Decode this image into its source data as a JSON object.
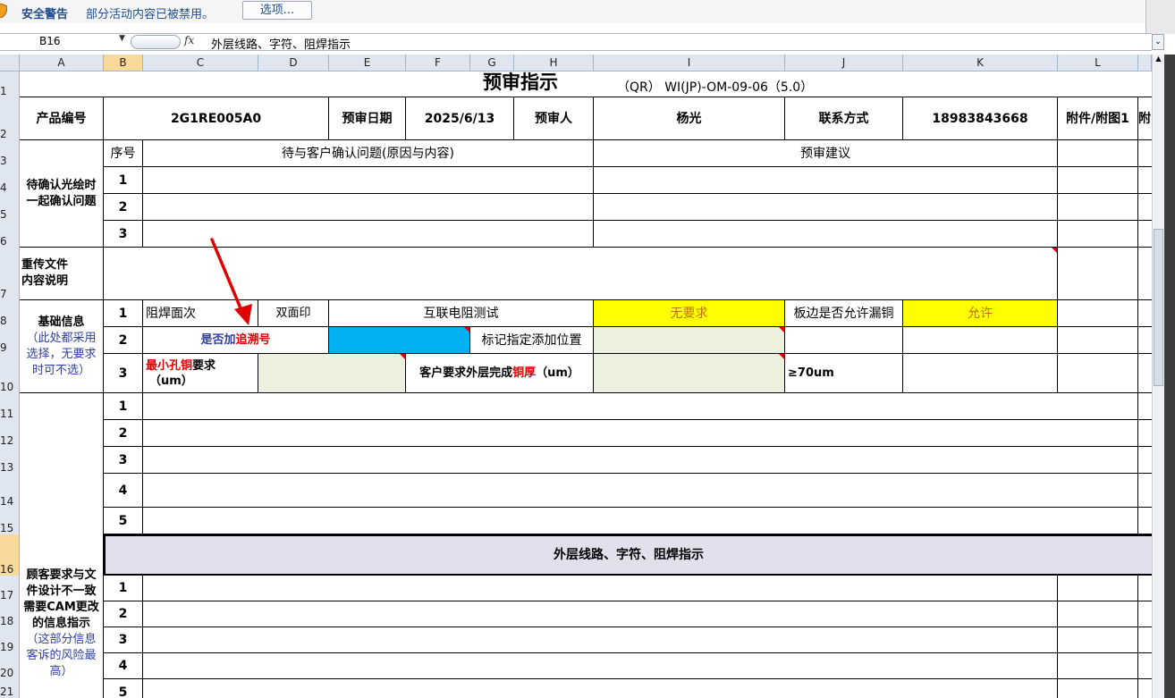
{
  "security_bar": {
    "title": "安全警告",
    "message": "部分活动内容已被禁用。",
    "options_button": "选项..."
  },
  "formula_bar": {
    "name_box": "B16",
    "fx": "fx",
    "value": "外层线路、字符、阻焊指示"
  },
  "columns": [
    "A",
    "B",
    "C",
    "D",
    "E",
    "F",
    "G",
    "H",
    "I",
    "J",
    "K",
    "L"
  ],
  "rows": [
    "1",
    "2",
    "3",
    "4",
    "5",
    "6",
    "7",
    "8",
    "9",
    "10",
    "11",
    "12",
    "13",
    "14",
    "15",
    "16",
    "17",
    "18",
    "19",
    "20",
    "21"
  ],
  "sheet": {
    "title": "预审指示",
    "form_code": "（QR） WI(JP)-OM-09-06（5.0）",
    "product_no_label": "产品编号",
    "product_no": "2G1RE005A0",
    "review_date_label": "预审日期",
    "review_date": "2025/6/13",
    "reviewer_label": "预审人",
    "reviewer": "杨光",
    "contact_label": "联系方式",
    "contact": "18983843668",
    "attachment_label": "附件/附图1",
    "attachment_label2": "附",
    "seq_label": "序号",
    "pending_issues_label": "待与客户确认问题(原因与内容)",
    "review_advice_label": "预审建议",
    "confirm_section": "待确认光绘时一起确认问题",
    "reupload_label": "重传文件\n内容说明",
    "basic_info_label": "基础信息",
    "basic_info_note": "（此处都采用选择，无要求时可不选）",
    "n1": "1",
    "n2": "2",
    "n3": "3",
    "n4": "4",
    "n5": "5",
    "mask_side_label": "阻焊面次",
    "mask_side_value": "双面印",
    "interconnect_label": "互联电阻测试",
    "interconnect_value": "无要求",
    "edge_copper_label": "板边是否允许漏铜",
    "edge_copper_value": "允许",
    "trace_label_a": "是否加",
    "trace_label_b": "追溯号",
    "mark_position_label": "标记指定添加位置",
    "min_hole_a": "最小孔铜",
    "min_hole_b": "要求",
    "min_hole_c": "（um）",
    "outer_cu_a": "客户要求外层完成",
    "outer_cu_b": "铜厚",
    "outer_cu_c": "（um）",
    "outer_cu_value": "≥70um",
    "cam_section": "顾客要求与文件设计不一致需要CAM更改的信息指示",
    "cam_note": "（这部分信息客诉的风险最高）",
    "outer_layer_header": "外层线路、字符、阻焊指示"
  },
  "colors": {
    "yellow": "#ffff00",
    "cyan": "#00b0f0",
    "light_green": "#ebf1de",
    "lavender": "#e4dfec",
    "arrow": "#e00000"
  }
}
